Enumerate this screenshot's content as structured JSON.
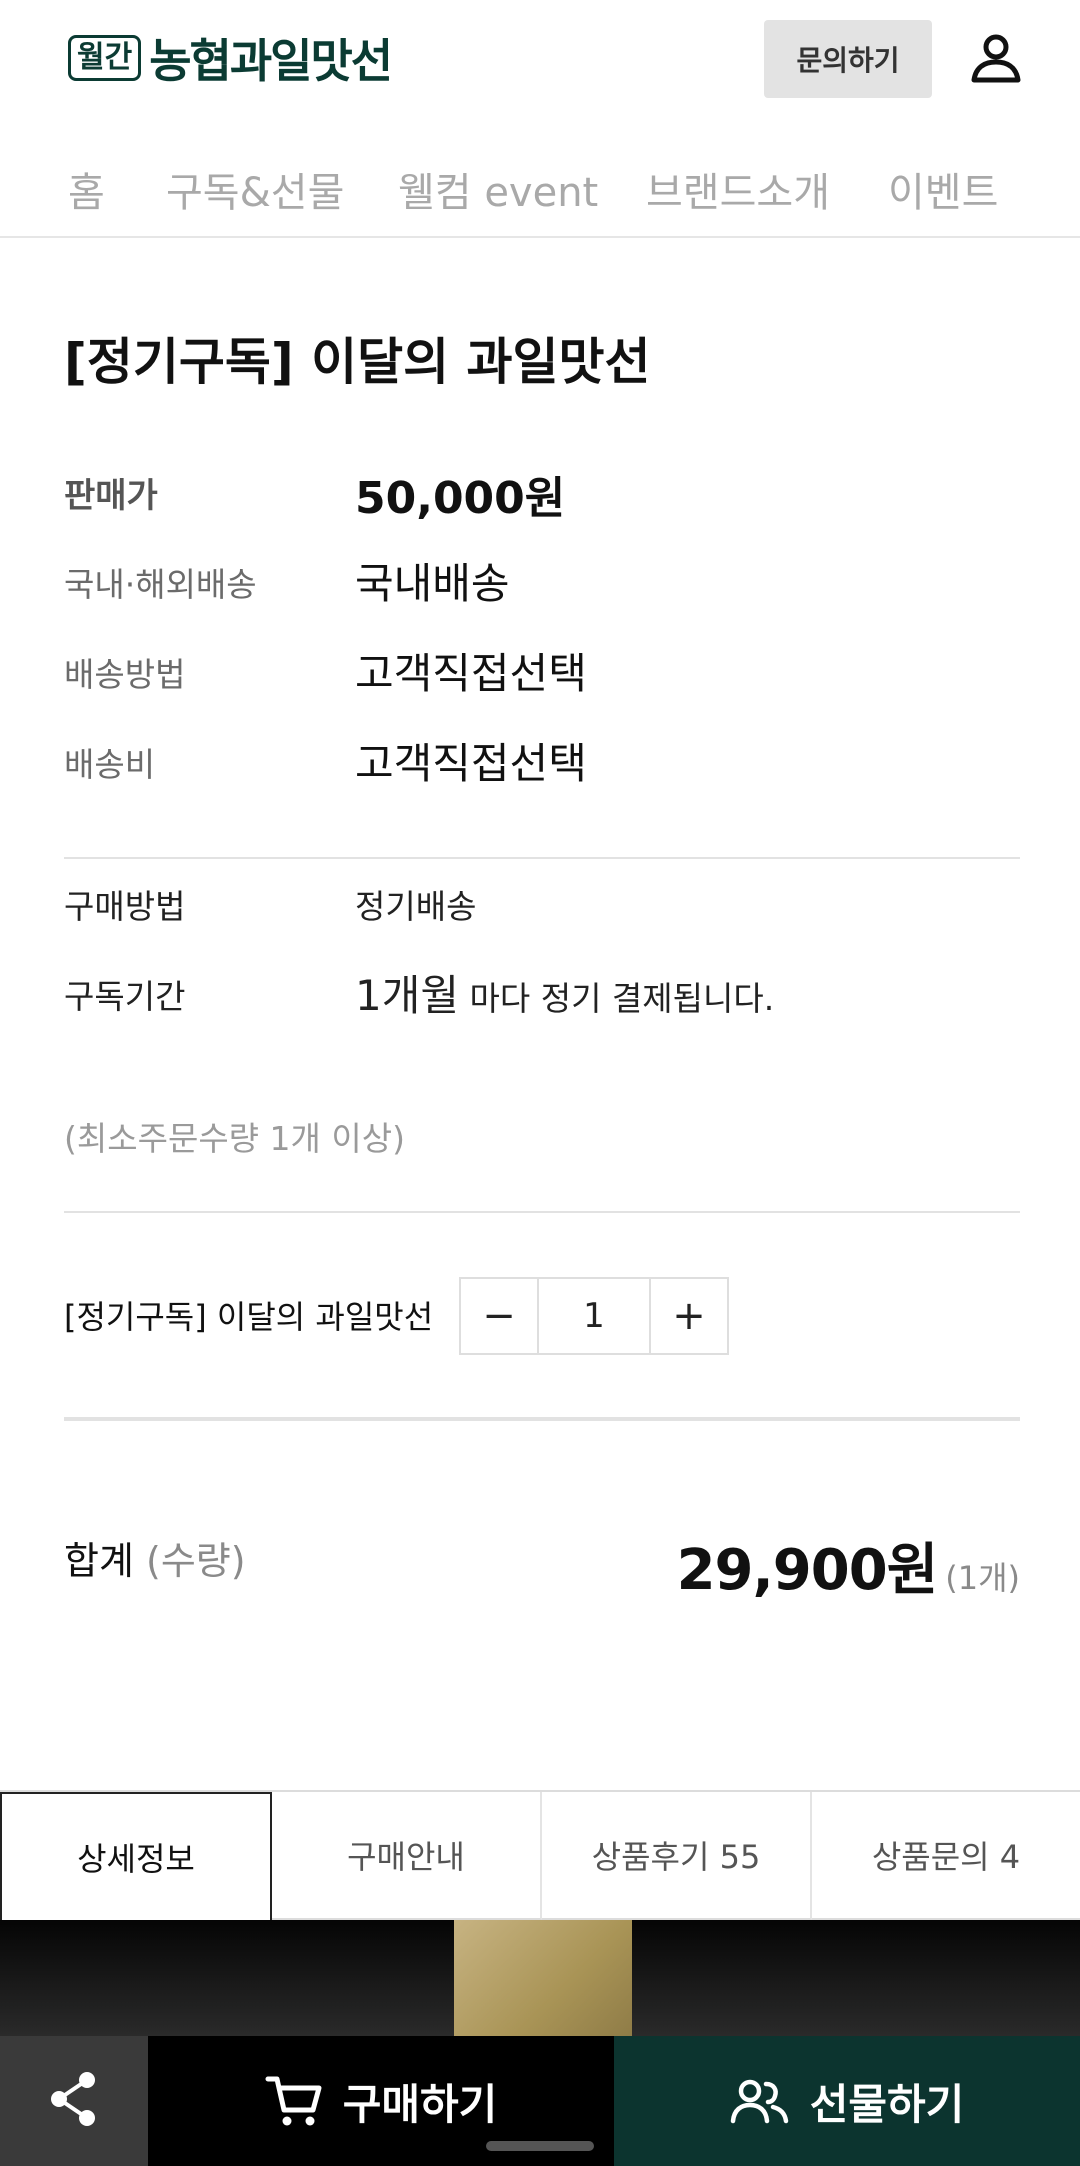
{
  "header": {
    "logo_badge": "월간",
    "logo_text": "농협과일맛선",
    "inquiry_label": "문의하기"
  },
  "nav": {
    "items": [
      "홈",
      "구독&선물",
      "웰컴 event",
      "브랜드소개",
      "이벤트"
    ]
  },
  "product": {
    "title": "[정기구독] 이달의 과일맛선",
    "rows": [
      {
        "label": "판매가",
        "value": "50,000원"
      },
      {
        "label": "국내·해외배송",
        "value": "국내배송"
      },
      {
        "label": "배송방법",
        "value": "고객직접선택"
      },
      {
        "label": "배송비",
        "value": "고객직접선택"
      }
    ],
    "purchase_method_label": "구매방법",
    "purchase_method_value": "정기배송",
    "subscription_period_label": "구독기간",
    "subscription_period_value": "1개월",
    "subscription_period_suffix": "마다 정기 결제됩니다.",
    "min_qty_note": "(최소주문수량 1개 이상)"
  },
  "quantity": {
    "item_label": "[정기구독] 이달의 과일맛선",
    "minus": "−",
    "value": "1",
    "plus": "+"
  },
  "total": {
    "label": "합계",
    "label_suffix": "(수량)",
    "price": "29,900원",
    "count": "(1개)"
  },
  "tabs": [
    {
      "label": "상세정보",
      "active": true
    },
    {
      "label": "구매안내",
      "active": false
    },
    {
      "label": "상품후기 55",
      "active": false
    },
    {
      "label": "상품문의 4",
      "active": false
    }
  ],
  "bottom_bar": {
    "share_icon": "share-icon",
    "buy_label": "구매하기",
    "gift_label": "선물하기"
  },
  "colors": {
    "brand": "#0b3b33",
    "gift_button": "#0c342f",
    "buy_button": "#000000",
    "share_button": "#3a3a3a"
  }
}
